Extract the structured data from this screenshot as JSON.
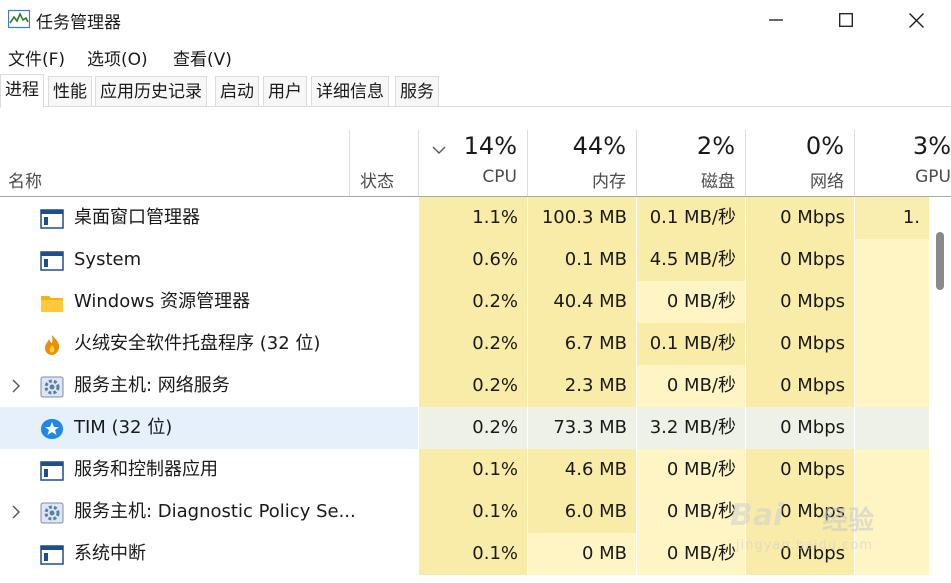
{
  "window": {
    "title": "任务管理器",
    "icons": {
      "app": "task-manager-chart-icon",
      "minimize": "minimize-icon",
      "maximize": "maximize-icon",
      "close": "close-icon"
    }
  },
  "menu": [
    "文件(F)",
    "选项(O)",
    "查看(V)"
  ],
  "tabs": [
    "进程",
    "性能",
    "应用历史记录",
    "启动",
    "用户",
    "详细信息",
    "服务"
  ],
  "active_tab": "进程",
  "columns": {
    "name": "名称",
    "status": "状态",
    "cpu": {
      "percent": "14%",
      "label": "CPU"
    },
    "memory": {
      "percent": "44%",
      "label": "内存"
    },
    "disk": {
      "percent": "2%",
      "label": "磁盘"
    },
    "network": {
      "percent": "0%",
      "label": "网络"
    },
    "gpu": {
      "percent": "3%",
      "label": "GPU"
    },
    "sort_indicator": "chevron-down-icon"
  },
  "colors": {
    "heat_light": "#fff4c4",
    "heat_medium": "#f9eca8",
    "selected_row": "#e5f0fb",
    "cpu_cell_highlight": "#faedb0"
  },
  "rows": [
    {
      "icon": "window-app-icon",
      "expandable": false,
      "name": "桌面窗口管理器",
      "cpu": "1.1%",
      "memory": "100.3 MB",
      "disk": "0.1 MB/秒",
      "network": "0 Mbps",
      "gpu": "1.",
      "selected": false,
      "heat": {
        "cpu": "m",
        "memory": "m",
        "disk": "m",
        "network": "m",
        "gpu": "m"
      }
    },
    {
      "icon": "window-app-icon",
      "expandable": false,
      "name": "System",
      "cpu": "0.6%",
      "memory": "0.1 MB",
      "disk": "4.5 MB/秒",
      "network": "0 Mbps",
      "gpu": "",
      "selected": false,
      "heat": {
        "cpu": "m",
        "memory": "m",
        "disk": "m",
        "network": "m",
        "gpu": "l"
      }
    },
    {
      "icon": "folder-icon",
      "expandable": false,
      "name": "Windows 资源管理器",
      "cpu": "0.2%",
      "memory": "40.4 MB",
      "disk": "0 MB/秒",
      "network": "0 Mbps",
      "gpu": "",
      "selected": false,
      "heat": {
        "cpu": "m",
        "memory": "m",
        "disk": "l",
        "network": "m",
        "gpu": "l"
      }
    },
    {
      "icon": "huorong-flame-icon",
      "expandable": false,
      "name": "火绒安全软件托盘程序 (32 位)",
      "cpu": "0.2%",
      "memory": "6.7 MB",
      "disk": "0.1 MB/秒",
      "network": "0 Mbps",
      "gpu": "",
      "selected": false,
      "heat": {
        "cpu": "m",
        "memory": "m",
        "disk": "m",
        "network": "m",
        "gpu": "l"
      }
    },
    {
      "icon": "gear-service-icon",
      "expandable": true,
      "name": "服务主机: 网络服务",
      "cpu": "0.2%",
      "memory": "2.3 MB",
      "disk": "0 MB/秒",
      "network": "0 Mbps",
      "gpu": "",
      "selected": false,
      "heat": {
        "cpu": "m",
        "memory": "m",
        "disk": "l",
        "network": "m",
        "gpu": "l"
      }
    },
    {
      "icon": "tim-star-icon",
      "expandable": false,
      "name": "TIM (32 位)",
      "cpu": "0.2%",
      "memory": "73.3 MB",
      "disk": "3.2 MB/秒",
      "network": "0 Mbps",
      "gpu": "",
      "selected": true,
      "heat": {
        "cpu": "s",
        "memory": "s",
        "disk": "s",
        "network": "s",
        "gpu": "s"
      }
    },
    {
      "icon": "window-app-icon",
      "expandable": false,
      "name": "服务和控制器应用",
      "cpu": "0.1%",
      "memory": "4.6 MB",
      "disk": "0 MB/秒",
      "network": "0 Mbps",
      "gpu": "",
      "selected": false,
      "heat": {
        "cpu": "m",
        "memory": "m",
        "disk": "l",
        "network": "m",
        "gpu": "l"
      }
    },
    {
      "icon": "gear-service-icon",
      "expandable": true,
      "name": "服务主机: Diagnostic Policy Se...",
      "cpu": "0.1%",
      "memory": "6.0 MB",
      "disk": "0 MB/秒",
      "network": "0 Mbps",
      "gpu": "",
      "selected": false,
      "heat": {
        "cpu": "m",
        "memory": "m",
        "disk": "l",
        "network": "m",
        "gpu": "l"
      }
    },
    {
      "icon": "window-app-icon",
      "expandable": false,
      "name": "系统中断",
      "cpu": "0.1%",
      "memory": "0 MB",
      "disk": "0 MB/秒",
      "network": "0 Mbps",
      "gpu": "",
      "selected": false,
      "heat": {
        "cpu": "m",
        "memory": "l",
        "disk": "l",
        "network": "m",
        "gpu": "l"
      }
    }
  ],
  "watermark": {
    "brand": "Bai",
    "brand_suffix": "经验",
    "url": "jingyan.baidu.com"
  }
}
